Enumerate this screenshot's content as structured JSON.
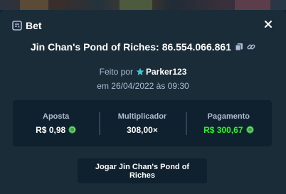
{
  "header": {
    "title": "Bet"
  },
  "game": {
    "name": "Jin Chan's Pond of Riches",
    "separator": ":",
    "bet_id": "86.554.066.861"
  },
  "made_by": {
    "prefix": "Feito por",
    "username": "Parker123"
  },
  "date": {
    "text": "em 26/04/2022 às 09:30"
  },
  "stats": {
    "bet": {
      "label": "Aposta",
      "value": "R$ 0,98"
    },
    "multiplier": {
      "label": "Multiplicador",
      "value": "308,00×"
    },
    "payout": {
      "label": "Pagamento",
      "value": "R$ 300,67"
    }
  },
  "play_button": {
    "label": "Jogar Jin Chan's Pond of Riches"
  },
  "colors": {
    "modal_bg": "#1a2c38",
    "panel_bg": "#0f212e",
    "muted_text": "#b1bad3",
    "payout_green": "#1fff20",
    "coin_green": "#3aa14a"
  },
  "icons": {
    "header": "bet-slip-icon",
    "close": "close-icon",
    "copy": "copy-icon",
    "link": "link-icon",
    "user_badge": "star-icon",
    "currency": "coin-icon"
  }
}
